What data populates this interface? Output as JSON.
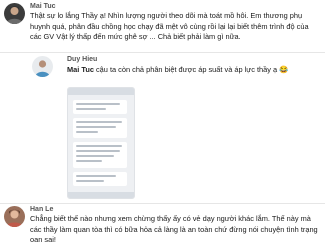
{
  "comments": [
    {
      "author": "Mai Tuc",
      "text": "Thật sự lo lắng Thầy ạ! Nhìn lượng người theo dõi mà toát mồ hôi. Em thương phụ huynh quá, phân đầu chồng học chạy đã mệt vô cùng rồi lại lại biết thêm trình độ của các GV Vật lý thấp đến mức ghê sợ ... Chả biết phải làm gì nữa."
    },
    {
      "author": "Duy Hieu",
      "mention": "Mai Tuc",
      "text": "cậu ta còn chả phân biệt được áp suất và áp lực thầy ạ",
      "emoji": "😂"
    },
    {
      "author": "Han Le",
      "text": "Chẳng biết thế nào nhưng xem chừng thấy ấy có vẻ dạy người khác lắm. Thế này mà các thầy làm quan tòa thì có bữa hỏa cả làng là an toàn chứ đừng nói chuyện tình trạng oan sai!"
    }
  ],
  "colors": {
    "name": "#555555",
    "text": "#1a1a1a",
    "divider": "#e6e6e6",
    "avatar1": "#3b3b3b",
    "avatar2": "#e8ebee",
    "avatar3": "#9a6f5a"
  }
}
